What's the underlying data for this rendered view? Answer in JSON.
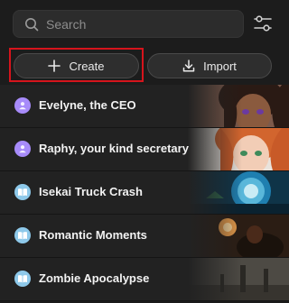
{
  "search": {
    "placeholder": "Search"
  },
  "actions": {
    "create_label": "Create",
    "import_label": "Import"
  },
  "colors": {
    "persona_icon": "#a78bfa",
    "story_icon": "#8ec9ea",
    "highlight": "#d6141c"
  },
  "items": [
    {
      "label": "Evelyne, the CEO",
      "icon": "person-icon"
    },
    {
      "label": "Raphy, your kind secretary",
      "icon": "person-icon"
    },
    {
      "label": "Isekai Truck Crash",
      "icon": "book-icon"
    },
    {
      "label": "Romantic Moments",
      "icon": "book-icon"
    },
    {
      "label": "Zombie Apocalypse",
      "icon": "book-icon"
    }
  ]
}
